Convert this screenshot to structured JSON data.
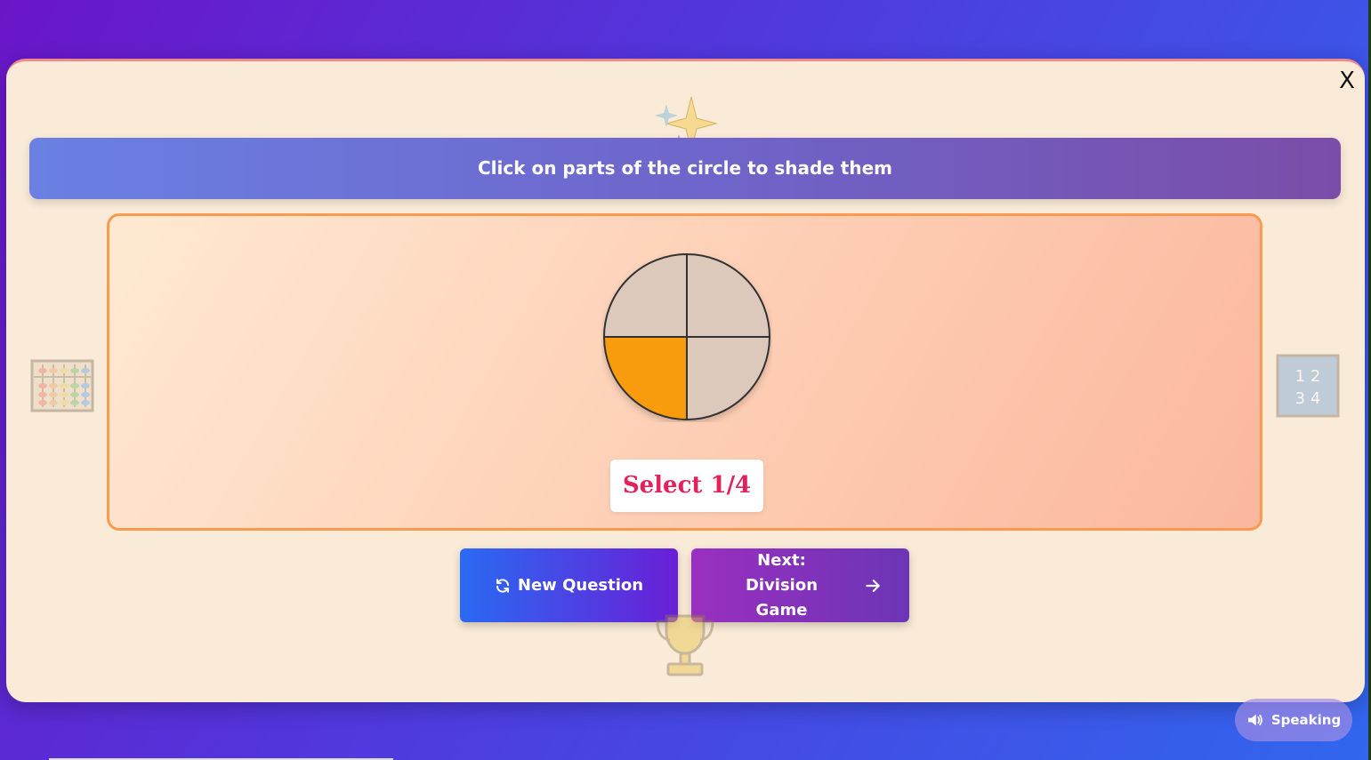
{
  "modal": {
    "close_label": "X",
    "instruction": "Click on parts of the circle to shade them",
    "target": "Select 1/4",
    "fraction": {
      "parts": 4,
      "shaded_parts": [
        2
      ]
    },
    "colors": {
      "shaded": "#f89b10",
      "unshaded": "#dcc9bc",
      "target_text": "#e3215a"
    },
    "deco_numbers": [
      "1 2",
      "3 4"
    ]
  },
  "buttons": {
    "new_question": "New Question",
    "next_line1": "Next: Division",
    "next_line2": "Game"
  },
  "speaking": {
    "label": "Speaking"
  }
}
